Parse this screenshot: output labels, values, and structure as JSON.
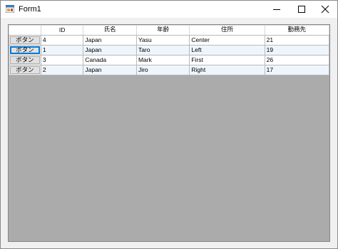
{
  "window": {
    "title": "Form1",
    "icon": "winforms-app-icon",
    "controls": [
      "minimize-icon",
      "maximize-icon",
      "close-icon"
    ]
  },
  "grid": {
    "columns": [
      "",
      "ID",
      "氏名",
      "年齢",
      "住所",
      "勤務先"
    ],
    "rows": [
      {
        "button": "ボタン",
        "cells": [
          "4",
          "Japan",
          "Yasu",
          "Center",
          "21"
        ]
      },
      {
        "button": "ボタン",
        "cells": [
          "1",
          "Japan",
          "Taro",
          "Left",
          "19"
        ]
      },
      {
        "button": "ボタン",
        "cells": [
          "3",
          "Canada",
          "Mark",
          "First",
          "26"
        ]
      },
      {
        "button": "ボタン",
        "cells": [
          "2",
          "Japan",
          "Jiro",
          "Right",
          "17"
        ]
      }
    ],
    "colors": {
      "background": "#ababab",
      "alt_row": "#eef5fd",
      "focus": "#0078d7"
    }
  }
}
